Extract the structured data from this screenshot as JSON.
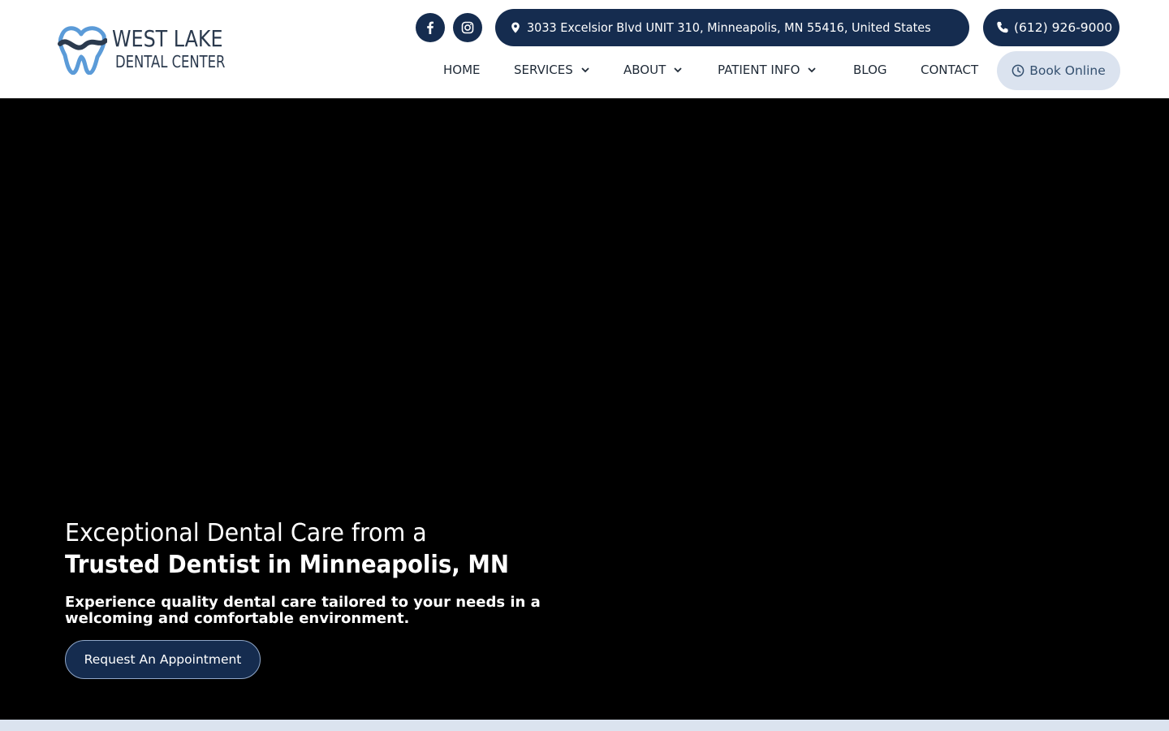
{
  "colors": {
    "brand_navy": "#152c4f",
    "book_bg": "#dbe3ef",
    "book_text": "#34506f",
    "logo_blue": "#5b9bd8",
    "logo_dark": "#2b3a4e"
  },
  "logo": {
    "line1": "WEST LAKE",
    "line2": "DENTAL CENTER",
    "icon": "tooth-logo-icon"
  },
  "social": {
    "facebook_icon": "facebook-icon",
    "instagram_icon": "instagram-icon"
  },
  "contact": {
    "address": "3033 Excelsior Blvd UNIT 310, Minneapolis, MN 55416, United States",
    "address_icon": "map-pin-icon",
    "phone": "(612) 926-9000",
    "phone_icon": "phone-icon"
  },
  "nav": {
    "home": "HOME",
    "services": "SERVICES",
    "about": "ABOUT",
    "patient_info": "PATIENT INFO",
    "blog": "BLOG",
    "contact": "CONTACT",
    "book_online": "Book Online",
    "book_icon": "clock-icon",
    "dropdown_icon": "chevron-down-icon"
  },
  "hero": {
    "line1": "Exceptional Dental Care from a",
    "line2": "Trusted Dentist in Minneapolis, MN",
    "subtitle": "Experience quality dental care tailored to your needs in a welcoming and comfortable environment.",
    "cta": "Request An Appointment"
  }
}
